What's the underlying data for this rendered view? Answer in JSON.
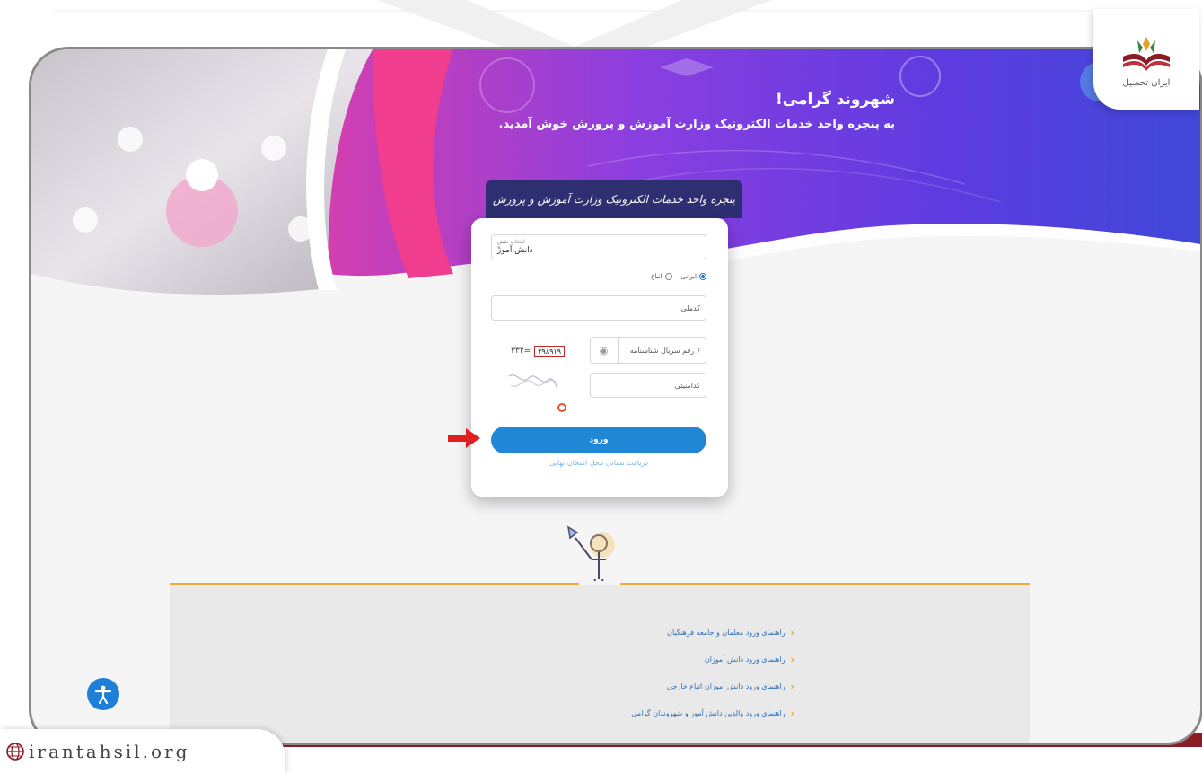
{
  "hero": {
    "title": "شهروند گرامی!",
    "subtitle": "به پنجره واحد خدمات الکترونیک وزارت آموزش و پرورش خوش آمدید."
  },
  "login": {
    "tab_label": "پنجره واحد خدمات الکترونیک وزارت آموزش و پرورش",
    "role_label": "انتخاب نقش",
    "role_value": "دانش آموز",
    "radio_iranian": "ایرانی",
    "radio_foreign": "اتباع",
    "code_placeholder": "کدملی",
    "serial_placeholder": "۶ رقم سریال شناسنامه",
    "captcha_placeholder": "کدامنیتی",
    "captcha_code": "۳۹۸۹۱۹",
    "captcha_extra": "=۳۳۲",
    "login_button": "ورود",
    "exam_link": "دریافت نشانی محل امتحان نهایی"
  },
  "guides": [
    "راهنمای ورود معلمان و جامعه فرهنگیان",
    "راهنمای ورود دانش آموزان",
    "راهنمای ورود دانش آموزان اتباع خارجی",
    "راهنمای ورود والدین دانش آموز و شهروندان گرامی"
  ],
  "brand": {
    "logo_text": "ایران تحصیل",
    "watermark": "irantahsil.org"
  },
  "colors": {
    "accent_blue": "#1f87d6",
    "hero_purple": "#6c3ce0",
    "hero_pink": "#e64aa0",
    "dark_red": "#8a1c26",
    "orange": "#f0a840"
  }
}
